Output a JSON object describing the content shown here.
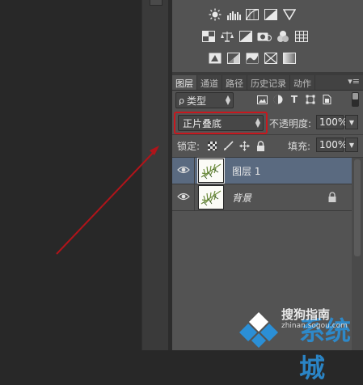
{
  "panel": {
    "tabs": [
      "图层",
      "通道",
      "路径",
      "历史记录",
      "动作"
    ],
    "active_tab_index": 0,
    "menu_glyph": "▾≡"
  },
  "filter": {
    "kind_label": "类型",
    "kind_prefix": "ρ",
    "filter_icons": [
      "image-filter-icon",
      "adjustment-filter-icon",
      "type-filter-icon",
      "shape-filter-icon",
      "smart-object-filter-icon"
    ]
  },
  "blend": {
    "mode": "正片叠底",
    "opacity_label": "不透明度:",
    "opacity_value": "100%",
    "highlight_color": "#c8181e"
  },
  "lock": {
    "label": "锁定:",
    "fill_label": "填充:",
    "fill_value": "100%",
    "icons": [
      "lock-transparent-icon",
      "lock-paint-icon",
      "lock-move-icon",
      "lock-all-icon"
    ]
  },
  "layers": [
    {
      "name": "图层 1",
      "selected": true,
      "visible": true,
      "locked": false
    },
    {
      "name": "背景",
      "selected": false,
      "visible": true,
      "locked": true
    }
  ],
  "adjustments": {
    "row1": [
      "brightness-icon",
      "levels-icon",
      "curves-icon",
      "exposure-icon",
      "triangle-icon"
    ],
    "row2": [
      "vibrance-icon",
      "balance-icon",
      "bw-icon",
      "photo-filter-icon",
      "channel-mixer-icon",
      "color-lookup-icon"
    ],
    "row3": [
      "invert-icon",
      "posterize-icon",
      "threshold-icon",
      "gradient-map-icon",
      "selective-color-icon"
    ]
  },
  "watermark": {
    "brand": "搜狗指南",
    "url": "zhinan.sogou.com",
    "big_text": "系统城"
  },
  "colors": {
    "panel_bg": "#535353",
    "selected_layer": "#5a6a80",
    "arrow": "#b0141a"
  }
}
